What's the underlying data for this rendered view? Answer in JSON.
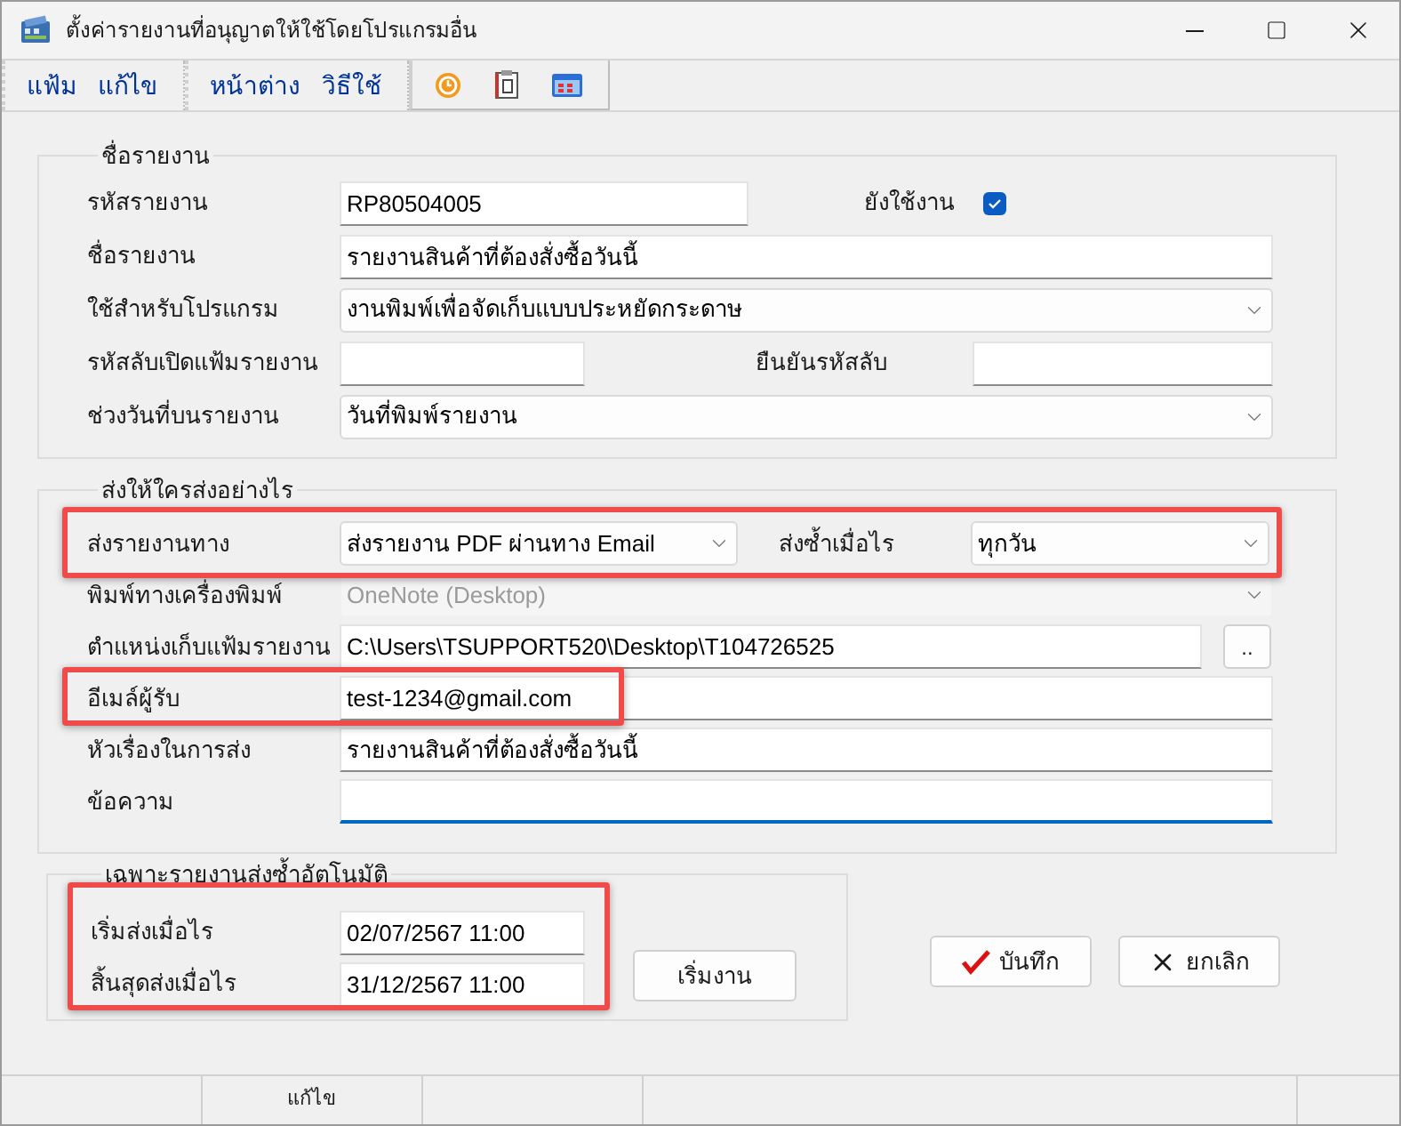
{
  "window": {
    "title": "ตั้งค่ารายงานที่อนุญาตให้ใช้โดยโปรแกรมอื่น"
  },
  "menu_groups": [
    [
      "แฟ้ม",
      "แก้ไข"
    ],
    [
      "หน้าต่าง",
      "วิธีใช้"
    ]
  ],
  "report_section": {
    "title": "ชื่อรายงาน",
    "report_code": {
      "label": "รหัสรายงาน",
      "value": "RP80504005"
    },
    "active": {
      "label": "ยังใช้งาน",
      "checked": true
    },
    "report_name": {
      "label": "ชื่อรายงาน",
      "value": "รายงานสินค้าที่ต้องสั่งซื้อวันนี้"
    },
    "program": {
      "label": "ใช้สำหรับโปรแกรม",
      "value": "งานพิมพ์เพื่อจัดเก็บแบบประหยัดกระดาษ"
    },
    "password": {
      "label": "รหัสลับเปิดแฟ้มรายงาน"
    },
    "confirm_password": {
      "label": "ยืนยันรหัสลับ"
    },
    "date_range": {
      "label": "ช่วงวันที่บนรายงาน",
      "value": "วันที่พิมพ์รายงาน"
    }
  },
  "send_section": {
    "title": "ส่งให้ใครส่งอย่างไร",
    "first_row_highlighted": true,
    "send_via": {
      "label": "ส่งรายงานทาง",
      "value": "ส่งรายงาน PDF ผ่านทาง Email"
    },
    "repeat": {
      "label": "ส่งซ้ำเมื่อไร",
      "value": "ทุกวัน"
    },
    "printer": {
      "label": "พิมพ์ทางเครื่องพิมพ์",
      "value": "OneNote (Desktop)",
      "disabled": true
    },
    "folder": {
      "label": "ตำแหน่งเก็บแฟ้มรายงาน",
      "value": "C:\\Users\\TSUPPORT520\\Desktop\\T104726525",
      "browse_label": ".."
    },
    "email": {
      "label": "อีเมล์ผู้รับ",
      "value": "test-1234@gmail.com",
      "highlighted": true
    },
    "subject": {
      "label": "หัวเรื่องในการส่ง",
      "value": "รายงานสินค้าที่ต้องสั่งซื้อวันนี้"
    },
    "message": {
      "label": "ข้อความ",
      "focused": true
    }
  },
  "auto_section": {
    "title": "เฉพาะรายงานส่งซ้ำอัตโนมัติ",
    "highlighted": true,
    "start": {
      "label": "เริ่มส่งเมื่อไร",
      "value": "02/07/2567 11:00"
    },
    "end": {
      "label": "สิ้นสุดส่งเมื่อไร",
      "value": "31/12/2567 11:00"
    },
    "start_button": "เริ่มงาน"
  },
  "buttons": [
    {
      "kind": "save",
      "label": "บันทึก"
    },
    {
      "kind": "cancel",
      "label": "ยกเลิก"
    }
  ],
  "status_bar": {
    "text": "แก้ไข"
  }
}
